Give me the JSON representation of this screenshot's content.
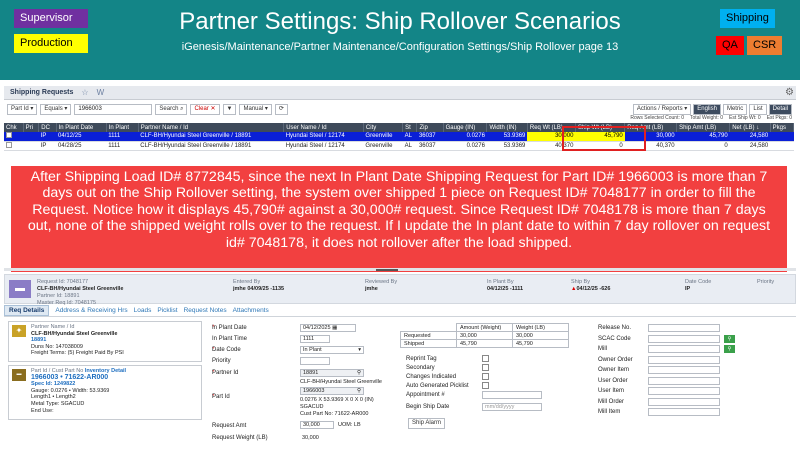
{
  "header": {
    "title": "Partner Settings: Ship Rollover Scenarios",
    "subtitle": "iGenesis/Maintenance/Partner Maintenance/Configuration Settings/Ship Rollover page 13",
    "tags": {
      "supervisor": "Supervisor",
      "production": "Production",
      "shipping": "Shipping",
      "qa": "QA",
      "csr": "CSR"
    }
  },
  "tabbar": {
    "title": "Shipping Requests",
    "star": "☆",
    "w": "W"
  },
  "toolbar": {
    "field": "Part Id",
    "operator": "Equals",
    "search_value": "1966003",
    "search": "Search",
    "clear": "Clear ✕",
    "filter_icon": "funnel-icon",
    "mode": "Manual",
    "refresh": "⟳",
    "actions": "Actions / Reports",
    "english": "English",
    "metric": "Metric",
    "list": "List",
    "detail": "Detail"
  },
  "counts": [
    "Rows Selected Count: 0",
    "Total Weight: 0",
    "Est Ship Wt: 0",
    "Est Pkgs: 0"
  ],
  "grid": {
    "columns": [
      "Chk",
      "Pri",
      "DC",
      "In Plant Date",
      "In Plant",
      "Partner Name / Id",
      "User Name / Id",
      "City",
      "St",
      "Zip",
      "Gauge (IN)",
      "Width (IN)",
      "Req Wt (LB)",
      "Ship Wt (LB)",
      "Req Amt (LB)",
      "Ship Amt (LB)",
      "Net (LB) ↓",
      "Pkgs"
    ],
    "rows": [
      [
        "",
        "",
        "IP",
        "04/12/25",
        "1111",
        "CLF-BH/Hyundai Steel Greenville / 18891",
        "Hyundai Steel / 12174",
        "Greenville",
        "AL",
        "36037",
        "0.0276",
        "53.9369",
        "30,000",
        "45,790",
        "30,000",
        "45,790",
        "24,580",
        ""
      ],
      [
        "",
        "",
        "IP",
        "04/28/25",
        "1111",
        "CLF-BH/Hyundai Steel Greenville / 18891",
        "Hyundai Steel / 12174",
        "Greenville",
        "AL",
        "36037",
        "0.0276",
        "53.9369",
        "40,370",
        "0",
        "40,370",
        "0",
        "24,580",
        ""
      ]
    ]
  },
  "callout": "After Shipping Load ID# 8772845, since the next In Plant Date Shipping Request for Part ID# 1966003 is more than 7 days out on the Ship Rollover setting, the system over shipped 1 piece on Request ID# 7048177 in order to fill the Request. Notice how it displays 45,790# against a 30,000# request. Since Request ID# 7048178 is more than 7 days out, none of the shipped weight rolls over to the request. If I update the In plant date to within 7 day rollover on request id# 7048178, it does not rollover after the load shipped.",
  "summary": {
    "request_id": "Request Id: 7048177",
    "partner": "CLF-BH/Hyundai Steel Greenville",
    "partner_id": "Partner Id: 18891",
    "master": "Master Req Id: 7048175",
    "entered_label": "Entered By",
    "entered": "jmhe 04/09/25 -1135",
    "reviewed_label": "Reviewed By",
    "reviewed": "jmhe",
    "inplant_label": "In Plant By",
    "inplant": "04/12/25 -1111",
    "shipby_label": "Ship By",
    "shipby": "04/12/25 -626",
    "datecode_label": "Date Code",
    "datecode": "IP",
    "priority_label": "Priority"
  },
  "detail_tabs": [
    "Req Details",
    "Address & Receiving Hrs",
    "Loads",
    "Picklist",
    "Request Notes",
    "Attachments"
  ],
  "partner_card": {
    "heading": "Partner Name / Id",
    "name": "CLF-BH/Hyundai Steel Greenville",
    "id": "18891",
    "duns": "Duns No: 147038009",
    "freight": "Freight Terms: (5) Freight Paid By PSI"
  },
  "part_card": {
    "heading": "Part Id / Cust Part No",
    "inv_link": "Inventory Detail",
    "part": "1966003 • 71622-AR000",
    "spec": "Spec Id: 1249822",
    "gauge": "Gauge: 0.0276 • Width: 53.9369",
    "length": "Length1 • Length2",
    "mtl": "Metal Type: SGACUD",
    "enduse": "End Use:"
  },
  "form": {
    "in_plant_date_label": "In Plant Date",
    "in_plant_date": "04/12/2025",
    "in_plant_time_label": "In Plant Time",
    "in_plant_time": "1111",
    "date_code_label": "Date Code",
    "date_code": "In Plant",
    "priority_label": "Priority",
    "partner_label": "Partner Id",
    "partner": "18891",
    "partner_name": "CLF-BH/Hyundai Steel Greenville",
    "part_label": "Part Id",
    "part": "1966003",
    "part_desc1": "0.0276 X 53.9369 X 0 X 0 (IN)",
    "part_desc2": "SGACUD",
    "part_desc3": "Cust Part No: 71622-AR000",
    "req_amt_label": "Request Amt",
    "req_amt": "30,000",
    "uom": "UOM: LB",
    "req_wt_label": "Request Weight (LB)",
    "req_wt": "30,000"
  },
  "weights": {
    "col1": "Amount (Weight)",
    "col2": "Weight (LB)",
    "req_label": "Requested",
    "req_amt": "30,000",
    "req_wt": "30,000",
    "ship_label": "Shipped",
    "ship_amt": "45,790",
    "ship_wt": "45,790"
  },
  "checks": [
    "Reprint Tag",
    "Secondary",
    "Changes Indicated",
    "Auto Generated Picklist"
  ],
  "appointment_label": "Appointment #",
  "begin_ship_label": "Begin Ship Date",
  "begin_ship_placeholder": "mm/dd/yyyy",
  "ship_alarm": "Ship Alarm",
  "right_fields": [
    "Release No.",
    "SCAC Code",
    "Mill",
    "Owner Order",
    "Owner Item",
    "User Order",
    "User Item",
    "Mill Order",
    "Mill Item"
  ]
}
